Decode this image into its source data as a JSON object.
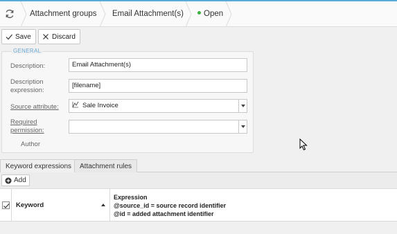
{
  "breadcrumb": {
    "items": [
      "Attachment groups",
      "Email Attachment(s)"
    ],
    "status": "Open",
    "status_color": "#3cb043"
  },
  "toolbar": {
    "save_label": "Save",
    "discard_label": "Discard"
  },
  "general": {
    "legend": "GENERAL",
    "description_label": "Description:",
    "description_value": "Email Attachment(s)",
    "description_expression_label": "Description expression:",
    "description_expression_value": "[filename]",
    "source_attribute_label": "Source attribute:",
    "source_attribute_value": "Sale Invoice",
    "required_permission_label": "Required permission:",
    "required_permission_value": "",
    "author_label": "Author"
  },
  "tabs": [
    "Keyword expressions",
    "Attachment rules"
  ],
  "grid": {
    "add_label": "Add",
    "col_keyword": "Keyword",
    "col_expression_lines": [
      "Expression",
      "@source_id = source record identifier",
      "@id = added attachment identifier"
    ]
  },
  "icons": {
    "refresh": "refresh-icon",
    "save": "check-icon",
    "discard": "x-icon",
    "add": "plus-circle-icon",
    "entity": "entity-icon"
  },
  "accent_color": "#5aaad8"
}
